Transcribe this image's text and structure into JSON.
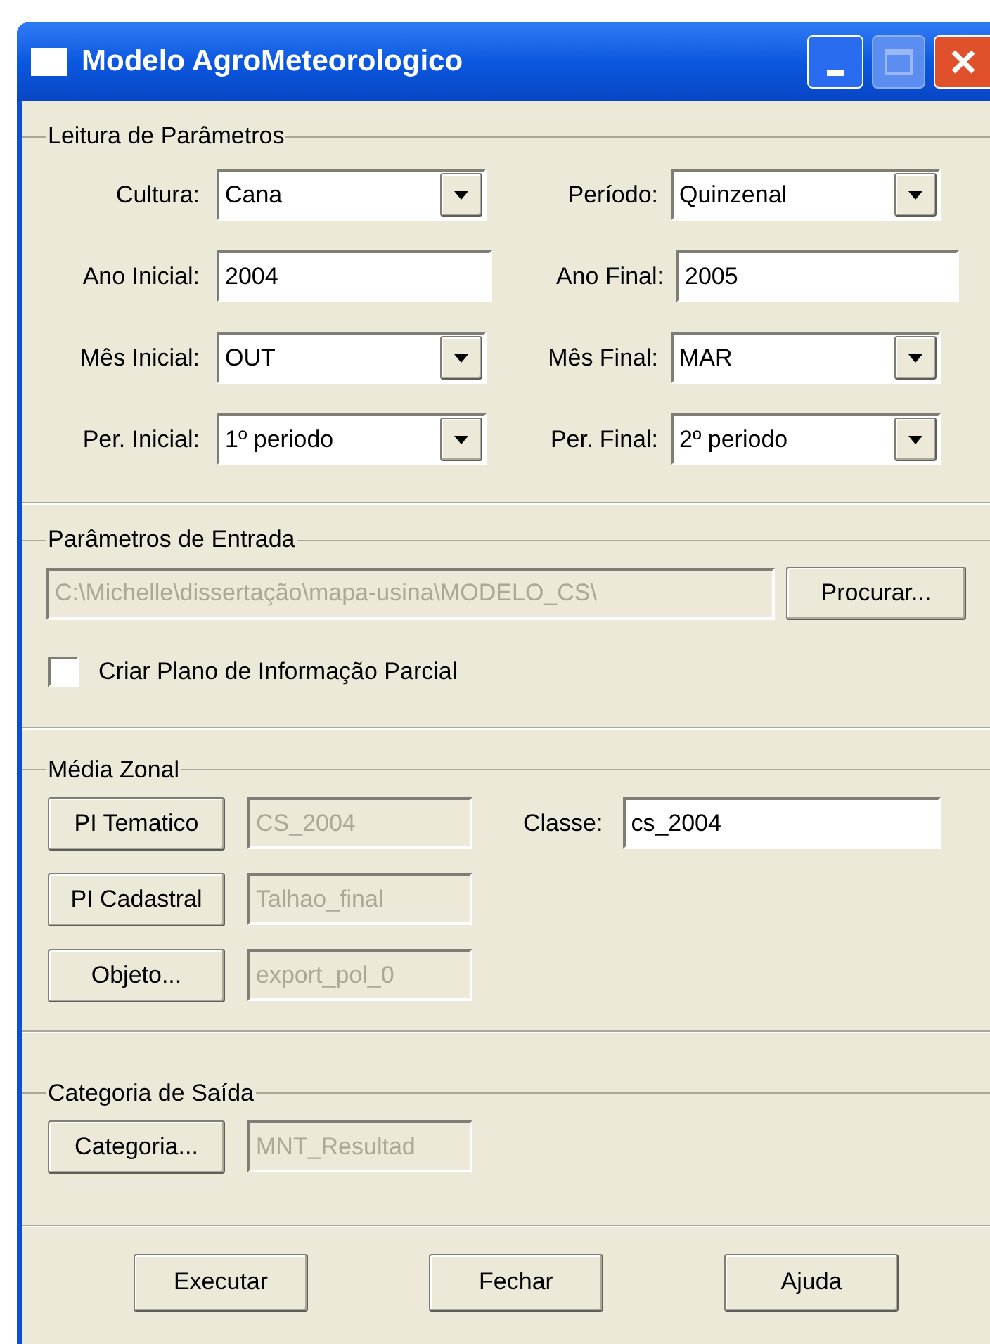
{
  "window": {
    "title": "Modelo AgroMeteorologico"
  },
  "leitura": {
    "title": "Leitura de Parâmetros",
    "rows": [
      [
        {
          "label": "Cultura:",
          "kind": "dropdown",
          "value": "Cana"
        },
        {
          "label": "Período:",
          "kind": "dropdown",
          "value": "Quinzenal"
        }
      ],
      [
        {
          "label": "Ano Inicial:",
          "kind": "text",
          "value": "2004"
        },
        {
          "label": "Ano Final:",
          "kind": "text",
          "value": "2005"
        }
      ],
      [
        {
          "label": "Mês Inicial:",
          "kind": "dropdown",
          "value": "OUT"
        },
        {
          "label": "Mês Final:",
          "kind": "dropdown",
          "value": "MAR"
        }
      ],
      [
        {
          "label": "Per. Inicial:",
          "kind": "dropdown",
          "value": "1º periodo"
        },
        {
          "label": "Per. Final:",
          "kind": "dropdown",
          "value": "2º periodo"
        }
      ]
    ]
  },
  "entrada": {
    "title": "Parâmetros de Entrada",
    "path": {
      "value": "C:\\Michelle\\dissertação\\mapa-usina\\MODELO_CS\\",
      "disabled": true
    },
    "browse_button": "Procurar...",
    "checkbox": {
      "label": "Criar Plano de Informação Parcial",
      "checked": false
    }
  },
  "media_zonal": {
    "title": "Média Zonal",
    "rows": [
      {
        "button": "PI Tematico",
        "value": "CS_2004",
        "disabled": true
      },
      {
        "button": "PI Cadastral",
        "value": "Talhao_final",
        "disabled": true
      },
      {
        "button": "Objeto...",
        "value": "export_pol_0",
        "disabled": true
      }
    ],
    "classe": {
      "label": "Classe:",
      "value": "cs_2004"
    }
  },
  "saida": {
    "title": "Categoria de Saída",
    "rows": [
      {
        "button": "Categoria...",
        "value": "MNT_Resultad",
        "disabled": true
      }
    ]
  },
  "buttons": [
    "Executar",
    "Fechar",
    "Ajuda"
  ]
}
